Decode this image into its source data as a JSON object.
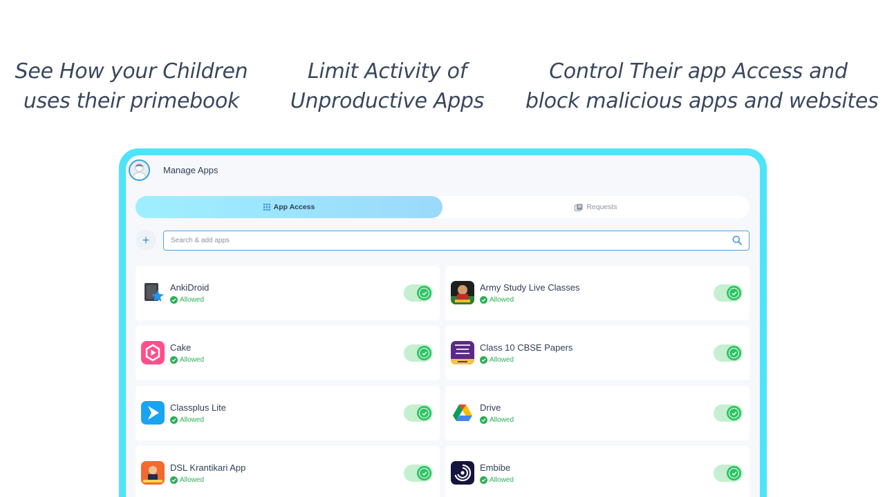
{
  "headlines": [
    {
      "line1": "See How your Children",
      "line2": "uses their primebook"
    },
    {
      "line1": "Limit Activity of",
      "line2": "Unproductive Apps"
    },
    {
      "line1": "Control Their app Access and",
      "line2": "block malicious apps and websites"
    }
  ],
  "header": {
    "title": "Manage Apps",
    "avatar_icon": "user-avatar-icon"
  },
  "tabs": [
    {
      "label": "App Access",
      "icon": "grid-icon",
      "active": true
    },
    {
      "label": "Requests",
      "icon": "requests-icon",
      "active": false
    }
  ],
  "search": {
    "placeholder": "Search & add apps",
    "value": "",
    "add_label": "+"
  },
  "apps": [
    {
      "name": "AnkiDroid",
      "status": "Allowed",
      "enabled": true
    },
    {
      "name": "Army Study Live Classes",
      "status": "Allowed",
      "enabled": true
    },
    {
      "name": "Cake",
      "status": "Allowed",
      "enabled": true
    },
    {
      "name": "Class 10 CBSE Papers",
      "status": "Allowed",
      "enabled": true
    },
    {
      "name": "Classplus Lite",
      "status": "Allowed",
      "enabled": true
    },
    {
      "name": "Drive",
      "status": "Allowed",
      "enabled": true
    },
    {
      "name": "DSL Krantikari App",
      "status": "Allowed",
      "enabled": true
    },
    {
      "name": "Embibe",
      "status": "Allowed",
      "enabled": true
    }
  ],
  "colors": {
    "frame": "#4de3f8",
    "allowed": "#2cae56",
    "toggle_on": "#2ec463"
  }
}
